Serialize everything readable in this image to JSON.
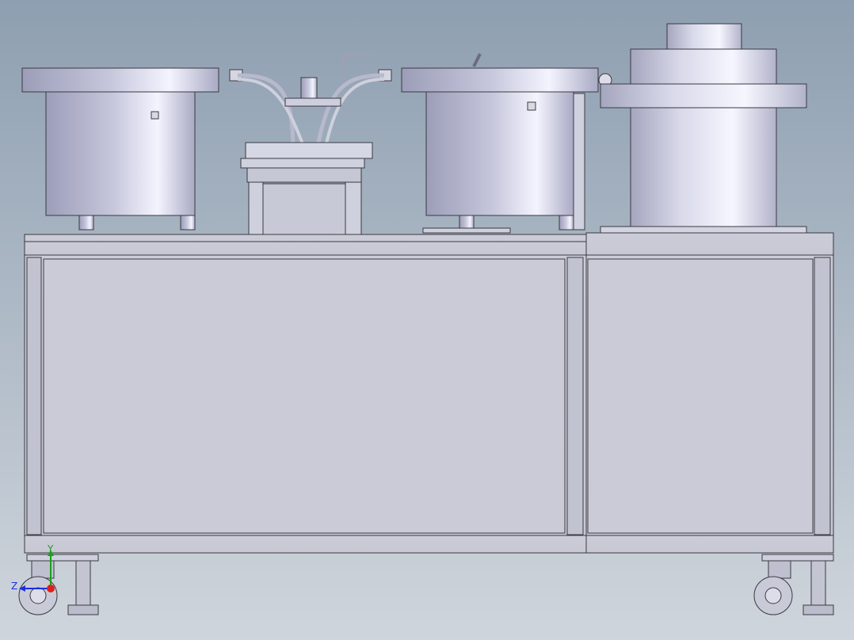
{
  "view": {
    "background_top": "#8e9fb1",
    "background_bottom": "#cfd5dc"
  },
  "triad": {
    "x_label": "",
    "y_label": "Y",
    "z_label": "Z",
    "x_color": "#e0201b",
    "y_color": "#1aa01a",
    "z_color": "#1a2fe0"
  },
  "model": {
    "body_fill": "#c9cad6",
    "edge_color": "#3a3a40",
    "metal_light": "#f2f2fb",
    "metal_mid": "#b9bad0",
    "metal_dark": "#8a8ba6"
  }
}
